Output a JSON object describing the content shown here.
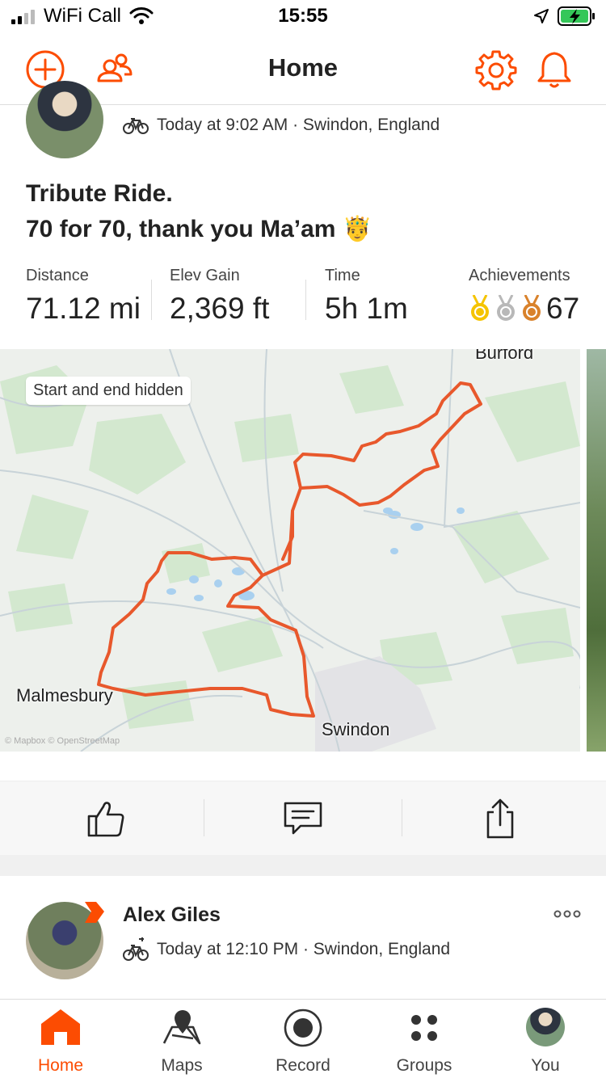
{
  "status_bar": {
    "carrier": "WiFi Call",
    "time": "15:55"
  },
  "header": {
    "title": "Home"
  },
  "activity1": {
    "meta": "Today at 9:02 AM · Swindon, England",
    "title_line1": "Tribute Ride.",
    "title_line2": "70 for 70, thank you Ma’am 🤴",
    "stats": {
      "distance_label": "Distance",
      "distance_value": "71.12 mi",
      "elev_label": "Elev Gain",
      "elev_value": "2,369 ft",
      "time_label": "Time",
      "time_value": "5h 1m",
      "achievements_label": "Achievements",
      "achievements_value": "67"
    },
    "map": {
      "badge": "Start and end hidden",
      "places": {
        "burford": "Burford",
        "malmesbury": "Malmesbury",
        "swindon": "Swindon"
      },
      "attribution": "© Mapbox © OpenStreetMap",
      "route_color": "#e8582c"
    }
  },
  "activity2": {
    "athlete": "Alex Giles",
    "meta": "Today at 12:10 PM · Swindon, England"
  },
  "tabs": [
    {
      "label": "Home",
      "icon": "home-icon",
      "active": true
    },
    {
      "label": "Maps",
      "icon": "map-icon"
    },
    {
      "label": "Record",
      "icon": "record-icon"
    },
    {
      "label": "Groups",
      "icon": "groups-icon"
    },
    {
      "label": "You",
      "icon": "profile-avatar"
    }
  ],
  "colors": {
    "accent": "#fc4c02",
    "gold": "#f5c400",
    "silver": "#b8b8b8",
    "bronze": "#d9822b"
  }
}
